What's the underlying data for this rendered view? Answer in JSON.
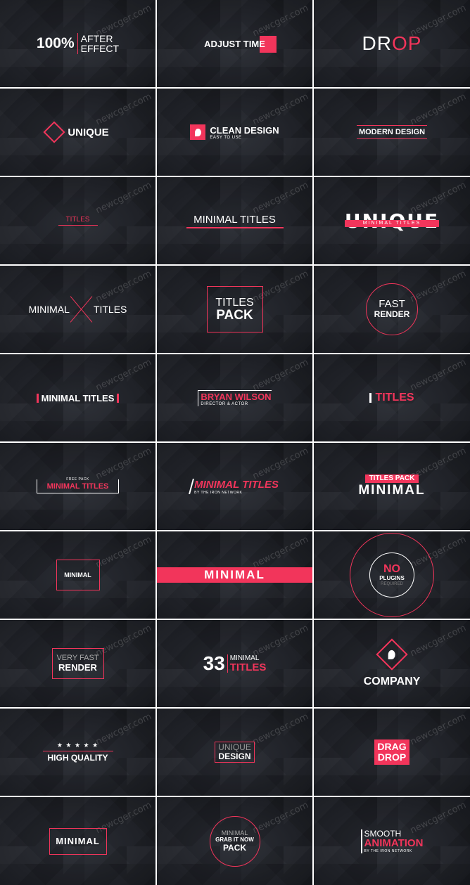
{
  "watermark": "newcger.com",
  "colors": {
    "accent": "#f2355b",
    "text": "#ffffff",
    "bg": "#1f2127"
  },
  "t1": {
    "a": "100%",
    "b": "AFTER",
    "c": "EFFECT"
  },
  "t2": {
    "a": "ADJUST TIME"
  },
  "t3": {
    "a": "DR",
    "b": "OP"
  },
  "t4": {
    "a": "UNIQUE"
  },
  "t5": {
    "a": "CLEAN DESIGN",
    "b": "EASY TO USE"
  },
  "t6": {
    "a": "MODERN DESIGN"
  },
  "t7": {
    "a": "TITLES"
  },
  "t8": {
    "a": "MINIMAL TITLES"
  },
  "t9": {
    "a": "UNIQUE",
    "b": "MINIMAL TITLES"
  },
  "t10": {
    "a": "MINIMAL",
    "b": "TITLES"
  },
  "t11": {
    "a": "TITLES",
    "b": "PACK"
  },
  "t12": {
    "a": "FAST",
    "b": "RENDER"
  },
  "t13": {
    "a": "MINIMAL TITLES"
  },
  "t14": {
    "a": "BRYAN WILSON",
    "b": "DIRECTOR & ACTOR"
  },
  "t15": {
    "a": "TITLES"
  },
  "t16": {
    "a": "FREE PACK",
    "b": "MINIMAL TITLES"
  },
  "t17": {
    "a": "MINIMAL TITLES",
    "b": "BY THE IRON NETWORK"
  },
  "t18": {
    "a": "TITLES PACK",
    "b": "MINIMAL"
  },
  "t19": {
    "a": "MINIMAL"
  },
  "t20": {
    "a": "MINIMAL"
  },
  "t21": {
    "a": "NO",
    "b": "PLUGINS",
    "c": "REQUIRED"
  },
  "t22": {
    "a": "VERY FAST",
    "b": "RENDER"
  },
  "t23": {
    "a": "33",
    "b": "MINIMAL",
    "c": "TITLES"
  },
  "t24": {
    "a": "COMPANY"
  },
  "t25": {
    "stars": "★ ★ ★ ★ ★",
    "a": "HIGH QUALITY"
  },
  "t26": {
    "a": "UNIQUE",
    "b": "DESIGN"
  },
  "t27": {
    "a": "DRAG",
    "b": "DROP"
  },
  "t28": {
    "a": "MINIMAL"
  },
  "t29": {
    "a": "MINIMAL",
    "b": "GRAB IT NOW",
    "c": "PACK"
  },
  "t30": {
    "a": "SMOOTH",
    "b": "ANIMATION",
    "c": "BY THE IRON NETWORK"
  }
}
